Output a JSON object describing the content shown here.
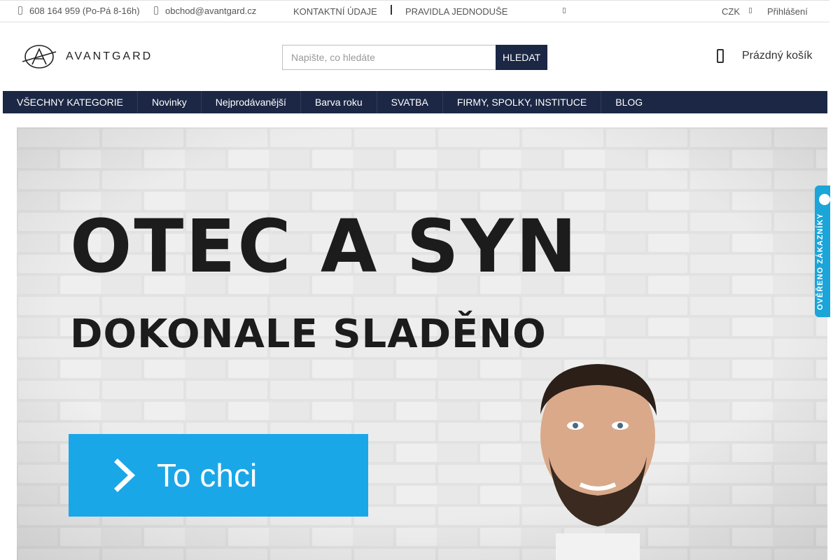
{
  "topbar": {
    "phone": "608 164 959 (Po-Pá 8-16h)",
    "email": "obchod@avantgard.cz",
    "contact_link": "KONTAKTNÍ ÚDAJE",
    "rules_link": "PRAVIDLA JEDNODUŠE",
    "currency": "CZK",
    "login": "Přihlášení"
  },
  "header": {
    "logo_text": "AVANTGARD",
    "search_placeholder": "Napište, co hledáte",
    "search_button": "HLEDAT",
    "cart_label": "Prázdný košík"
  },
  "nav": {
    "items": [
      {
        "label": "VŠECHNY KATEGORIE"
      },
      {
        "label": "Novinky"
      },
      {
        "label": "Nejprodávanější"
      },
      {
        "label": "Barva roku"
      },
      {
        "label": "SVATBA"
      },
      {
        "label": "FIRMY, SPOLKY, INSTITUCE"
      },
      {
        "label": "BLOG"
      }
    ]
  },
  "banner": {
    "title": "OTEC A SYN",
    "subtitle": "DOKONALE SLADĚNO",
    "cta_label": "To chci"
  },
  "verified_badge": {
    "label": "OVĚŘENO ZÁKAZNÍKY"
  },
  "colors": {
    "navy": "#1b2744",
    "cta_blue": "#1aa7e8",
    "badge_blue": "#1ba5d8"
  }
}
